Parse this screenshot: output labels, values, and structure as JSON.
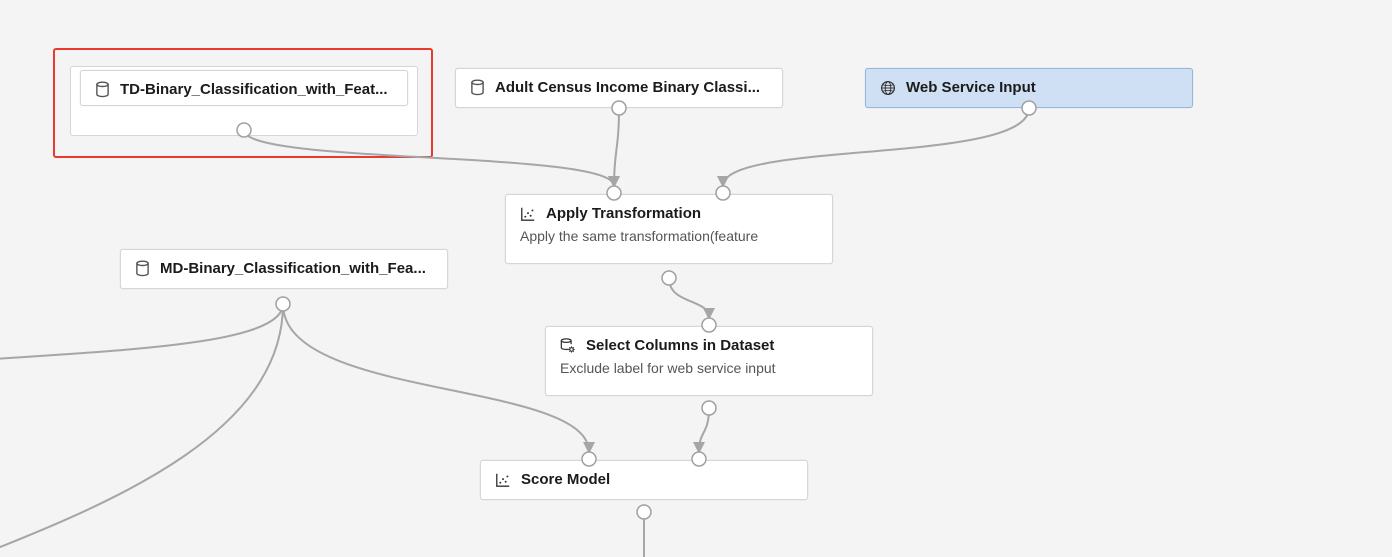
{
  "nodes": {
    "td": {
      "label": "TD-Binary_Classification_with_Feat...",
      "icon": "database"
    },
    "adult": {
      "label": "Adult Census Income Binary Classi...",
      "icon": "database"
    },
    "webinput": {
      "label": "Web Service Input",
      "icon": "globe"
    },
    "md": {
      "label": "MD-Binary_Classification_with_Fea...",
      "icon": "database"
    },
    "apply": {
      "label": "Apply Transformation",
      "sub": "Apply the same transformation(feature",
      "icon": "scatter"
    },
    "select": {
      "label": "Select Columns in Dataset",
      "sub": "Exclude label for web service input",
      "icon": "db-gear"
    },
    "score": {
      "label": "Score Model",
      "icon": "scatter"
    }
  }
}
